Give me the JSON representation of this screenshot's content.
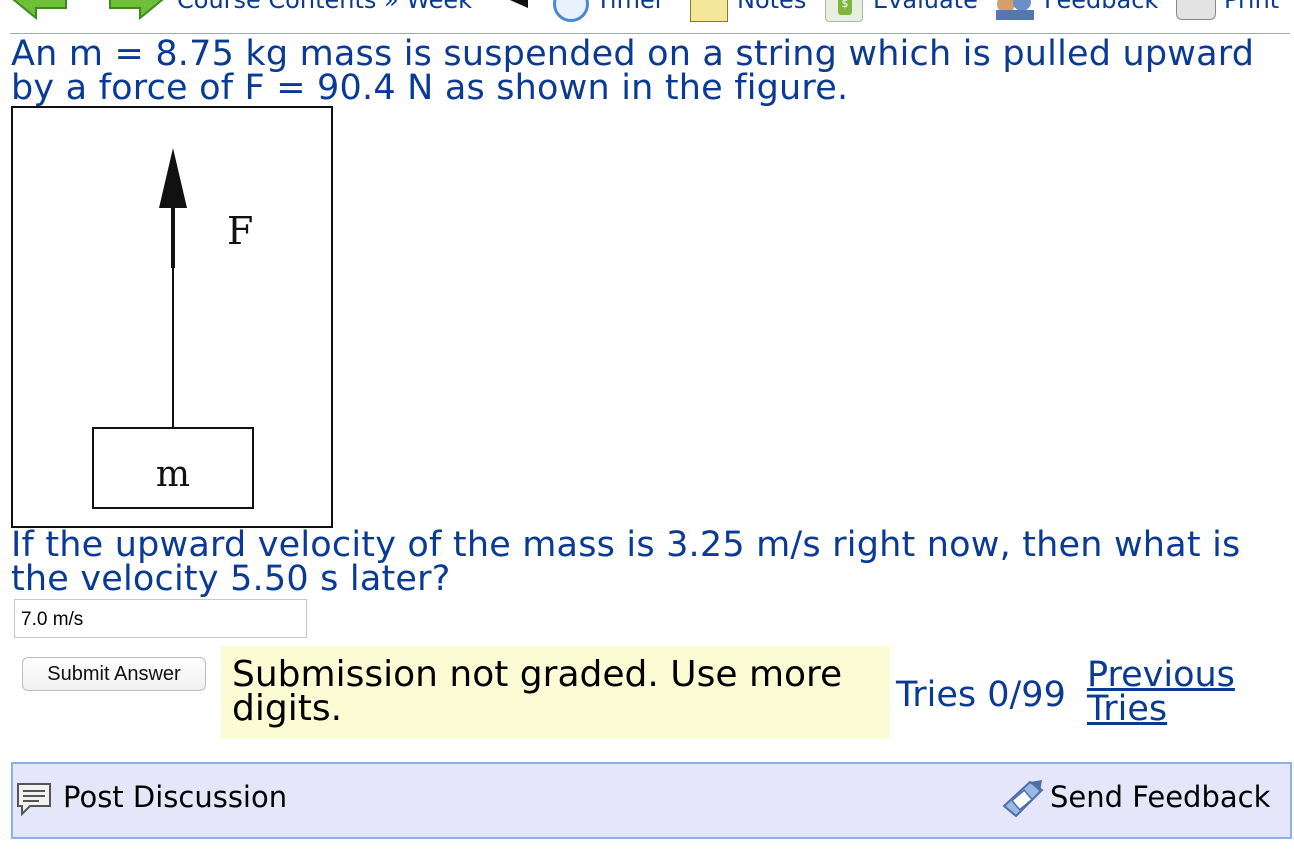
{
  "toolbar": {
    "breadcrumb": "Course Contents » Week",
    "timer_label": "Timer",
    "notes_label": "Notes",
    "evaluate_label": "Evaluate",
    "feedback_label": "Feedback",
    "print_label": "Print"
  },
  "problem": {
    "line1": "An m = 8.75 kg mass is suspended on a string which is pulled upward",
    "line2": "by a force of F = 90.4 N as shown in the figure.",
    "figure": {
      "force_label": "F",
      "mass_label": "m"
    },
    "question_line1": "If the upward velocity of the mass is 3.25 m/s right now, then what is",
    "question_line2": "the velocity 5.50 s later?"
  },
  "answer": {
    "value": "7.0 m/s"
  },
  "submit": {
    "button_label": "Submit Answer",
    "status_line1": "Submission not graded. Use more",
    "status_line2": "digits.",
    "tries": "Tries 0/99",
    "previous_tries_line1": "Previous",
    "previous_tries_line2": "Tries"
  },
  "footer": {
    "post_discussion": "Post Discussion",
    "send_feedback": "Send Feedback"
  },
  "colors": {
    "text_blue": "#0a3a94",
    "status_bg": "#fcfcd4",
    "bar_bg": "#e6e6fa",
    "bar_border": "#8ab2e6"
  }
}
